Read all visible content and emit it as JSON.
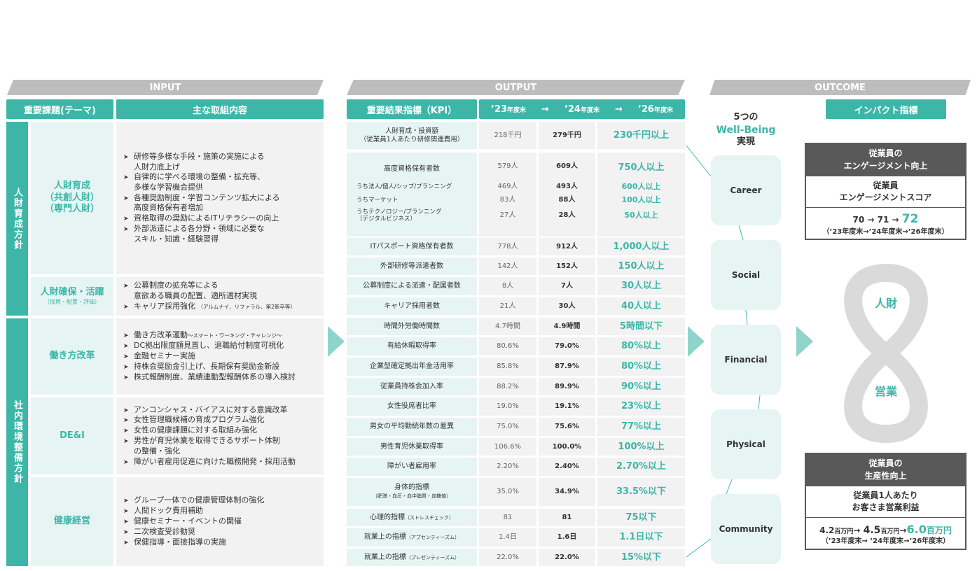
{
  "bands": {
    "input": "INPUT",
    "output": "OUTPUT",
    "outcome": "OUTCOME"
  },
  "headers": {
    "theme": "重要課題(テーマ)",
    "actions": "主な取組内容",
    "kpi": "重要結果指標（KPI）",
    "y23": "’23",
    "y23s": "年度末",
    "y24": "’24",
    "y24s": "年度末",
    "y26": "’26",
    "y26s": "年度末",
    "arrow": "→",
    "impact": "インパクト指標"
  },
  "policies": {
    "jinzai": "人財育成方針",
    "shanai": "社内環境整備方針"
  },
  "themes": [
    {
      "label": "人財育成\n（共創人財）\n（専門人財）",
      "sub": ""
    },
    {
      "label": "人財確保・活躍",
      "sub": "（採用・配置・評価）"
    },
    {
      "label": "働き方改革",
      "sub": ""
    },
    {
      "label": "DE&I",
      "sub": ""
    },
    {
      "label": "健康経営",
      "sub": ""
    }
  ],
  "actions": [
    [
      "研修等多様な手段・施策の実施による\n人財力底上げ",
      "自律的に学べる環境の整備・拡充等、\n多様な学習機会提供",
      "各種奨励制度・学習コンテンツ拡大による\n高度資格保有者増加",
      "資格取得の奨励によるITリテラシーの向上",
      "外部派遣による各分野・領域に必要な\nスキル・知識・経験習得"
    ],
    [
      "公募制度の拡充等による\n意欲ある職員の配置、適所適材実現",
      "キャリア採用強化"
    ],
    [
      "働き方改革運動",
      "DC拠出限度額見直し、退職給付制度可視化",
      "金融セミナー実施",
      "持株会奨励金引上げ、長期保有奨励金新設",
      "株式報酬制度、業績連動型報酬体系の導入検討"
    ],
    [
      "アンコンシャス・バイアスに対する意識改革",
      "女性管理職候補の育成プログラム強化",
      "女性の健康課題に対する取組み強化",
      "男性が育児休業を取得できるサポート体制\nの整備・強化",
      "障がい者雇用促進に向けた職務開発・採用活動"
    ],
    [
      "グループ一体での健康管理体制の強化",
      "人間ドック費用補助",
      "健康セミナー・イベントの開催",
      "二次検査受診勧奨",
      "保健指導・面接指導の実施"
    ]
  ],
  "action_notes": {
    "career": "（アルムナイ、リファラル、第2新卒等）",
    "hatarakikata": "～スマート・ワーキング・チャレンジ～"
  },
  "kpis": [
    {
      "name": "人財育成・投資額\n（従業員1人あたり研修関連費用）",
      "v23": "218千円",
      "v24": "279千円",
      "v26": "230千円以上"
    },
    {
      "name": "高度資格保有者数",
      "v23": "579人",
      "v24": "609人",
      "v26": "750人以上"
    },
    {
      "name": "うち法人/個人/シップ/プランニング",
      "v23": "469人",
      "v24": "493人",
      "v26": "600人以上"
    },
    {
      "name": "うちマーケット",
      "v23": "83人",
      "v24": "88人",
      "v26": "100人以上"
    },
    {
      "name": "うちテクノロジー/プランニング\n（デジタルビジネス）",
      "v23": "27人",
      "v24": "28人",
      "v26": "50人以上"
    },
    {
      "name": "ITパスポート資格保有者数",
      "v23": "778人",
      "v24": "912人",
      "v26": "1,000人以上"
    },
    {
      "name": "外部研修等派遣者数",
      "v23": "142人",
      "v24": "152人",
      "v26": "150人以上"
    },
    {
      "name": "公募制度による派遣・配属者数",
      "v23": "8人",
      "v24": "7人",
      "v26": "30人以上"
    },
    {
      "name": "キャリア採用者数",
      "v23": "21人",
      "v24": "30人",
      "v26": "40人以上"
    },
    {
      "name": "時間外労働時間数",
      "v23": "4.7時間",
      "v24": "4.9時間",
      "v26": "5時間以下"
    },
    {
      "name": "有給休暇取得率",
      "v23": "80.6%",
      "v24": "79.0%",
      "v26": "80%以上"
    },
    {
      "name": "企業型確定拠出年金活用率",
      "v23": "85.8%",
      "v24": "87.9%",
      "v26": "80%以上"
    },
    {
      "name": "従業員持株会加入率",
      "v23": "88.2%",
      "v24": "89.9%",
      "v26": "90%以上"
    },
    {
      "name": "女性役席者比率",
      "v23": "19.0%",
      "v24": "19.1%",
      "v26": "23%以上"
    },
    {
      "name": "男女の平均勤続年数の差異",
      "v23": "75.0%",
      "v24": "75.6%",
      "v26": "77%以上"
    },
    {
      "name": "男性育児休業取得率",
      "v23": "106.6%",
      "v24": "100.0%",
      "v26": "100%以上"
    },
    {
      "name": "障がい者雇用率",
      "v23": "2.20%",
      "v24": "2.40%",
      "v26": "2.70%以上"
    },
    {
      "name": "身体的指標",
      "note": "（肥満・血圧・血中脂質・血糖値）",
      "v23": "35.0%",
      "v24": "34.9%",
      "v26": "33.5%以下"
    },
    {
      "name": "心理的指標",
      "note": "（ストレスチェック）",
      "v23": "81",
      "v24": "81",
      "v26": "75以下"
    },
    {
      "name": "就業上の指標",
      "note": "（アブセンティーズム）",
      "v23": "1.4日",
      "v24": "1.6日",
      "v26": "1.1日以下"
    },
    {
      "name": "就業上の指標",
      "note": "（プレゼンティーズム）",
      "v23": "22.0%",
      "v24": "22.0%",
      "v26": "15%以下"
    }
  ],
  "wellbeing": {
    "title1": "5つの",
    "title2": "Well-Being",
    "title3": "実現",
    "items": [
      "Career",
      "Social",
      "Financial",
      "Physical",
      "Community"
    ]
  },
  "impact": {
    "engagement": {
      "head1": "従業員の",
      "head2": "エンゲージメント向上",
      "metric1": "従業員",
      "metric2": "エンゲージメントスコア",
      "v23": "70",
      "v24": "71",
      "v26": "72",
      "years": "（’23年度末→’24年度末→’26年度末）"
    },
    "productivity": {
      "head1": "従業員の",
      "head2": "生産性向上",
      "metric1": "従業員1人あたり",
      "metric2": "お客さま営業利益",
      "v23": "4.2",
      "v24": "4.5",
      "v26": "6.0",
      "unit": "百万円",
      "years": "（’23年度末→ ’24年度末→’26年度末）"
    }
  },
  "infinity": {
    "top": "人財",
    "bottom": "営業"
  },
  "colors": {
    "accent": "#3db6a8",
    "light": "#e6f5f3",
    "gray": "#595959"
  }
}
